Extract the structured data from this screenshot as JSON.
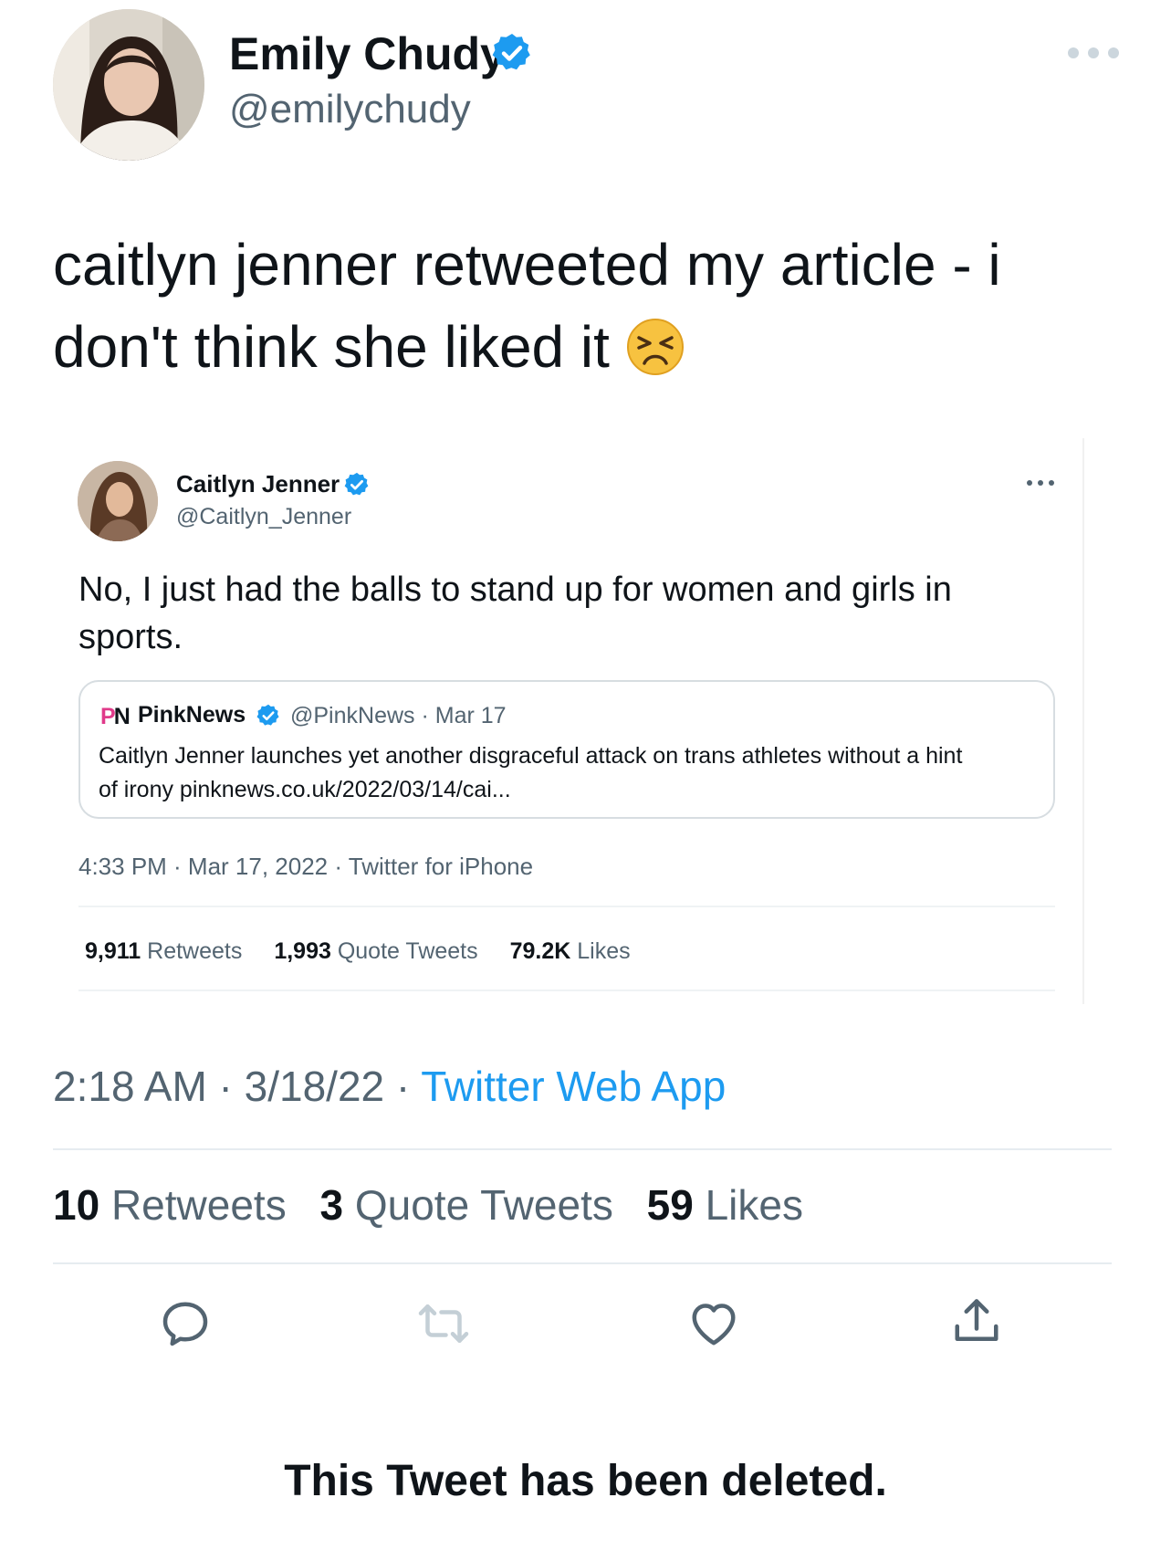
{
  "author": {
    "name": "Emily Chudy",
    "handle": "@emilychudy"
  },
  "tweet": {
    "line1": "caitlyn jenner retweeted my article - i",
    "line2": "don't think she liked it",
    "emoji": "persevering-face"
  },
  "embedded_tweet": {
    "name": "Caitlyn Jenner",
    "handle": "@Caitlyn_Jenner",
    "line1": "No, I just had the balls to stand up for women and girls in",
    "line2": "sports.",
    "quote": {
      "logo_p": "P",
      "logo_n": "N",
      "name": "PinkNews",
      "meta": "@PinkNews · Mar 17",
      "line1": "Caitlyn Jenner launches yet another disgraceful attack on trans athletes without a hint",
      "line2": "of irony pinknews.co.uk/2022/03/14/cai..."
    },
    "time": "4:33 PM · Mar 17, 2022 · Twitter for iPhone",
    "stats": {
      "retweets_count": "9,911",
      "retweets_label": "Retweets",
      "quotes_count": "1,993",
      "quotes_label": "Quote Tweets",
      "likes_count": "79.2K",
      "likes_label": "Likes"
    }
  },
  "meta": {
    "time_date": "2:18 AM · 3/18/22 · ",
    "app": "Twitter Web App"
  },
  "stats": {
    "retweets_count": "10",
    "retweets_label": "Retweets",
    "quotes_count": "3",
    "quotes_label": "Quote Tweets",
    "likes_count": "59",
    "likes_label": "Likes"
  },
  "actions": [
    "reply-icon",
    "retweet-icon",
    "like-icon",
    "share-icon"
  ],
  "deleted_notice": "This Tweet has been deleted.",
  "colors": {
    "verified": "#1d9bf0",
    "link": "#1d9bf0",
    "secondary_text": "#536471",
    "pinknews_pink": "#e03a8a"
  }
}
